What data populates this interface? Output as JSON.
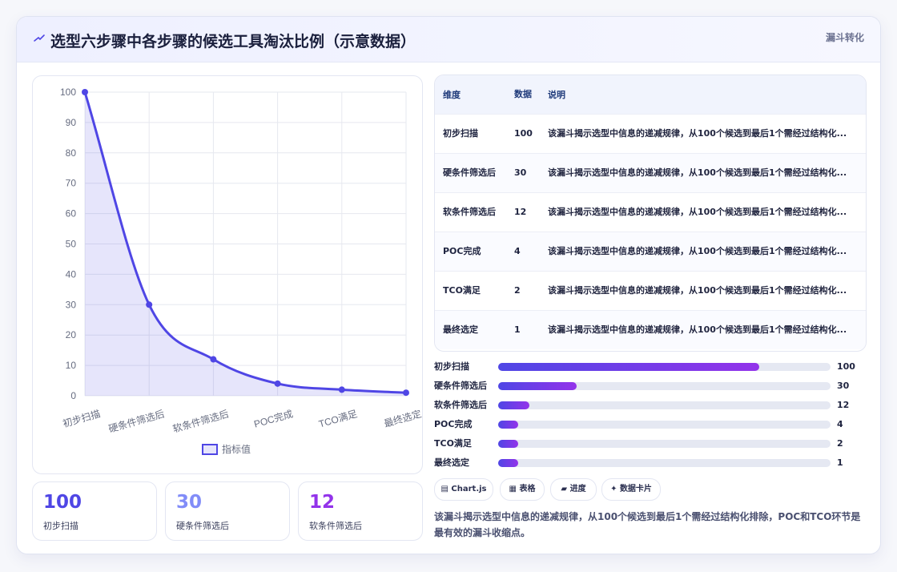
{
  "header": {
    "icon": "bolt-icon",
    "title": "选型六步骤中各步骤的候选工具淘汰比例（示意数据）",
    "badge": "漏斗转化"
  },
  "chart_data": {
    "type": "area",
    "categories": [
      "初步扫描",
      "硬条件筛选后",
      "软条件筛选后",
      "POC完成",
      "TCO满足",
      "最终选定"
    ],
    "series": [
      {
        "name": "指标值",
        "values": [
          100,
          30,
          12,
          4,
          2,
          1
        ]
      }
    ],
    "ylim": [
      0,
      100
    ],
    "yticks": [
      "0",
      "10",
      "20",
      "30",
      "40",
      "50",
      "60",
      "70",
      "80",
      "90",
      "100"
    ],
    "grid": true,
    "legend": "bottom",
    "color": "#4f46e5"
  },
  "kpis": [
    {
      "value": "100",
      "label": "初步扫描",
      "color": "#4f46e5"
    },
    {
      "value": "30",
      "label": "硬条件筛选后",
      "color": "#818cf8"
    },
    {
      "value": "12",
      "label": "软条件筛选后",
      "color": "#9333ea"
    }
  ],
  "table": {
    "headers": [
      "维度",
      "数据",
      "说明"
    ],
    "rows": [
      {
        "dim": "初步扫描",
        "num": "100",
        "desc": "该漏斗揭示选型中信息的递减规律，从100个候选到最后1个需经过结构化..."
      },
      {
        "dim": "硬条件筛选后",
        "num": "30",
        "desc": "该漏斗揭示选型中信息的递减规律，从100个候选到最后1个需经过结构化..."
      },
      {
        "dim": "软条件筛选后",
        "num": "12",
        "desc": "该漏斗揭示选型中信息的递减规律，从100个候选到最后1个需经过结构化..."
      },
      {
        "dim": "POC完成",
        "num": "4",
        "desc": "该漏斗揭示选型中信息的递减规律，从100个候选到最后1个需经过结构化..."
      },
      {
        "dim": "TCO满足",
        "num": "2",
        "desc": "该漏斗揭示选型中信息的递减规律，从100个候选到最后1个需经过结构化..."
      },
      {
        "dim": "最终选定",
        "num": "1",
        "desc": "该漏斗揭示选型中信息的递减规律，从100个候选到最后1个需经过结构化..."
      }
    ]
  },
  "progress": [
    {
      "label": "初步扫描",
      "value": "100",
      "pct": 0.785
    },
    {
      "label": "硬条件筛选后",
      "value": "30",
      "pct": 0.236
    },
    {
      "label": "软条件筛选后",
      "value": "12",
      "pct": 0.094
    },
    {
      "label": "POC完成",
      "value": "4",
      "pct": 0.06
    },
    {
      "label": "TCO满足",
      "value": "2",
      "pct": 0.06
    },
    {
      "label": "最终选定",
      "value": "1",
      "pct": 0.06
    }
  ],
  "chips": [
    {
      "icon": "▤",
      "label": "Chart.js"
    },
    {
      "icon": "▦",
      "label": "表格"
    },
    {
      "icon": "▰",
      "label": "进度"
    },
    {
      "icon": "✦",
      "label": "数据卡片"
    }
  ],
  "summary": "该漏斗揭示选型中信息的递减规律，从100个候选到最后1个需经过结构化排除，POC和TCO环节是最有效的漏斗收缩点。"
}
